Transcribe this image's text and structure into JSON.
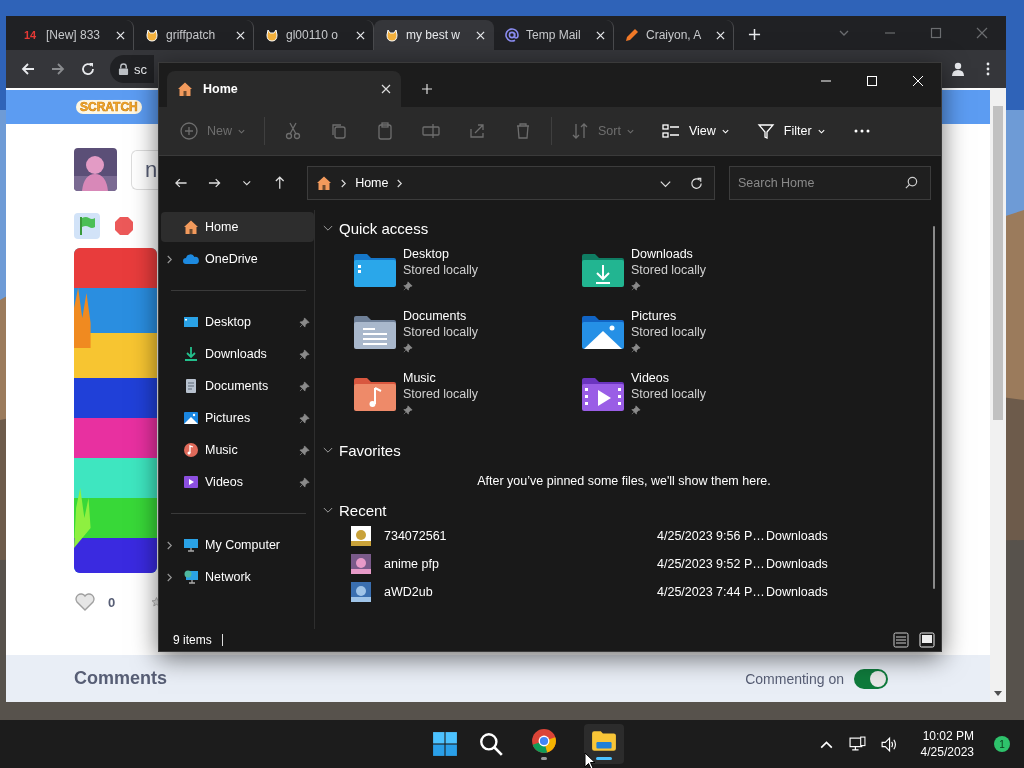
{
  "browser": {
    "tabs": [
      {
        "title": "[New] 833",
        "kind": "counter",
        "badge": "14",
        "selected": false
      },
      {
        "title": "griffpatch",
        "kind": "cat",
        "selected": false
      },
      {
        "title": "gl00110 o",
        "kind": "cat",
        "selected": false
      },
      {
        "title": "my best w",
        "kind": "cat",
        "selected": true
      },
      {
        "title": "Temp Mail",
        "kind": "at",
        "selected": false
      },
      {
        "title": "Craiyon, A",
        "kind": "pencil",
        "selected": false
      }
    ],
    "address": "sc",
    "page": {
      "logo": "SCRATCH",
      "project_title": "n",
      "loves": "0",
      "comments_heading": "Comments",
      "commenting_label": "Commenting on",
      "commenting_on": true
    }
  },
  "explorer": {
    "tab": "Home",
    "commands": [
      {
        "kind": "new",
        "label": "New",
        "disabled": true
      },
      {
        "kind": "cut",
        "disabled": true
      },
      {
        "kind": "copy",
        "disabled": true
      },
      {
        "kind": "paste",
        "disabled": true
      },
      {
        "kind": "rename",
        "disabled": true
      },
      {
        "kind": "share",
        "disabled": true
      },
      {
        "kind": "delete",
        "disabled": true
      },
      {
        "kind": "sort",
        "label": "Sort",
        "disabled": true
      },
      {
        "kind": "view",
        "label": "View",
        "disabled": false
      },
      {
        "kind": "filter",
        "label": "Filter",
        "disabled": false
      },
      {
        "kind": "more",
        "disabled": false
      }
    ],
    "breadcrumb": "Home",
    "search": {
      "placeholder": "Search Home"
    },
    "sidebar": [
      {
        "items": [
          {
            "label": "Home",
            "kind": "home",
            "selected": true,
            "expandable": false,
            "pinned": false
          },
          {
            "label": "OneDrive",
            "kind": "cloud",
            "selected": false,
            "expandable": true,
            "pinned": false
          }
        ]
      },
      {
        "items": [
          {
            "label": "Desktop",
            "kind": "desktop",
            "selected": false,
            "expandable": false,
            "pinned": true
          },
          {
            "label": "Downloads",
            "kind": "downloads",
            "selected": false,
            "expandable": false,
            "pinned": true
          },
          {
            "label": "Documents",
            "kind": "documents",
            "selected": false,
            "expandable": false,
            "pinned": true
          },
          {
            "label": "Pictures",
            "kind": "pictures",
            "selected": false,
            "expandable": false,
            "pinned": true
          },
          {
            "label": "Music",
            "kind": "music",
            "selected": false,
            "expandable": false,
            "pinned": true
          },
          {
            "label": "Videos",
            "kind": "videos",
            "selected": false,
            "expandable": false,
            "pinned": true
          }
        ]
      },
      {
        "items": [
          {
            "label": "My Computer",
            "kind": "computer",
            "selected": false,
            "expandable": true,
            "pinned": false
          },
          {
            "label": "Network",
            "kind": "network",
            "selected": false,
            "expandable": true,
            "pinned": false
          }
        ]
      }
    ],
    "quick_access": {
      "title": "Quick access",
      "items": [
        {
          "name": "Desktop",
          "status": "Stored locally",
          "kind": "desktop",
          "pinned": true
        },
        {
          "name": "Downloads",
          "status": "Stored locally",
          "kind": "downloads",
          "pinned": true
        },
        {
          "name": "Documents",
          "status": "Stored locally",
          "kind": "documents",
          "pinned": true
        },
        {
          "name": "Pictures",
          "status": "Stored locally",
          "kind": "pictures",
          "pinned": true
        },
        {
          "name": "Music",
          "status": "Stored locally",
          "kind": "music",
          "pinned": true
        },
        {
          "name": "Videos",
          "status": "Stored locally",
          "kind": "videos",
          "pinned": true
        }
      ]
    },
    "favorites": {
      "title": "Favorites",
      "message": "After you’ve pinned some files, we'll show them here."
    },
    "recent": {
      "title": "Recent",
      "files": [
        {
          "name": "734072561",
          "date": "4/25/2023 9:56 P…",
          "location": "Downloads",
          "kind": "sketch"
        },
        {
          "name": "anime pfp",
          "date": "4/25/2023 9:52 P…",
          "location": "Downloads",
          "kind": "pink"
        },
        {
          "name": "aWD2ub",
          "date": "4/25/2023 7:44 P…",
          "location": "Downloads",
          "kind": "sky"
        }
      ]
    },
    "status": "9 items"
  },
  "taskbar": {
    "time": "10:02 PM",
    "date": "4/25/2023",
    "notifications": "1"
  }
}
